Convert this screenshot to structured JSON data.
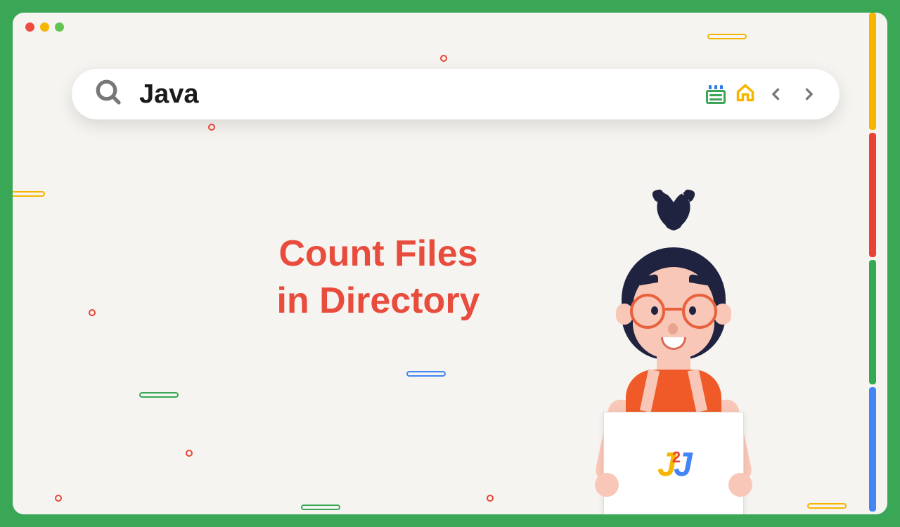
{
  "search": {
    "value": "Java"
  },
  "headline": {
    "line1": "Count Files",
    "line2": "in Directory"
  },
  "logo": {
    "part1": "J",
    "super": "2",
    "part2": "J"
  },
  "colors": {
    "accent": "#e84c3d",
    "green": "#3aa757"
  }
}
